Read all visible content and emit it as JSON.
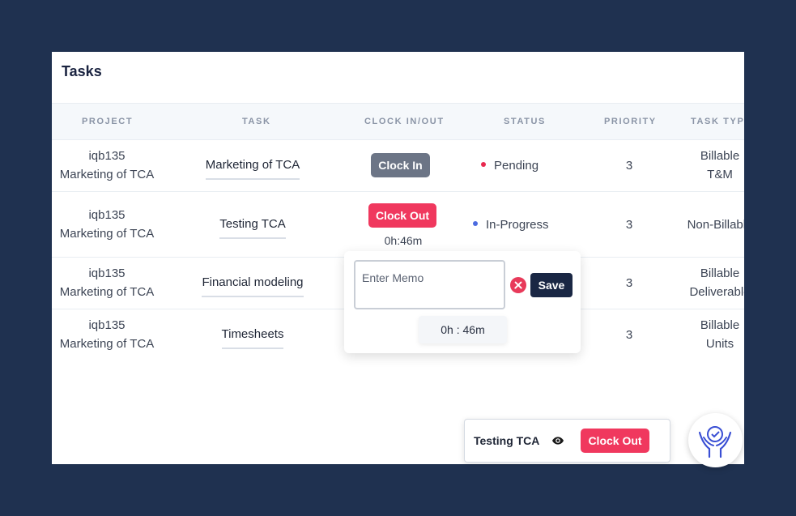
{
  "panel": {
    "title": "Tasks"
  },
  "columns": [
    "PROJECT",
    "TASK",
    "CLOCK IN/OUT",
    "STATUS",
    "PRIORITY",
    "TASK TYPE"
  ],
  "rows": [
    {
      "project_id": "iqb135",
      "project_name": "Marketing of TCA",
      "task": "Marketing of TCA",
      "clock_label": "Clock In",
      "status": "Pending",
      "priority": "3",
      "type_line1": "Billable",
      "type_line2": "T&M"
    },
    {
      "project_id": "iqb135",
      "project_name": "Marketing of TCA",
      "task": "Testing TCA",
      "clock_label": "Clock Out",
      "timer": "0h:46m",
      "status": "In-Progress",
      "priority": "3",
      "type_line1": "Non-Billable",
      "type_line2": ""
    },
    {
      "project_id": "iqb135",
      "project_name": "Marketing of TCA",
      "task": "Financial modeling",
      "priority": "3",
      "type_line1": "Billable",
      "type_line2": "Deliverable"
    },
    {
      "project_id": "iqb135",
      "project_name": "Marketing of TCA",
      "task": "Timesheets",
      "priority": "3",
      "type_line1": "Billable",
      "type_line2": "Units"
    }
  ],
  "status_colors": {
    "pending": "#e8294f",
    "in_progress": "#4c6be0"
  },
  "memo_popup": {
    "placeholder": "Enter Memo",
    "save_label": "Save",
    "timer": "0h : 46m"
  },
  "mini_bar": {
    "task": "Testing TCA",
    "button": "Clock Out"
  },
  "colors": {
    "accent": "#f0385e",
    "navy": "#1a2744",
    "background": "#1f3150"
  }
}
